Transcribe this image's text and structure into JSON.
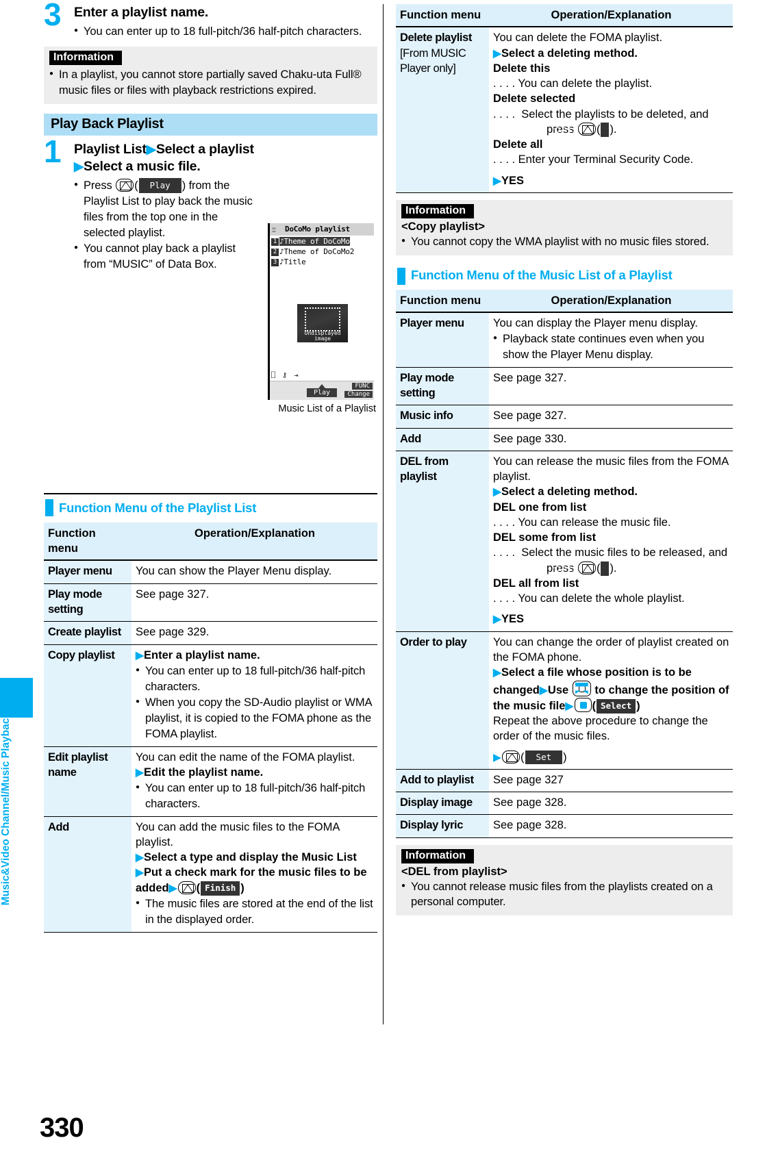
{
  "page": {
    "number": "330",
    "side_tab_label": "Music&Video Channel/Music Playback"
  },
  "left_column": {
    "step3": {
      "number": "3",
      "title": "Enter a playlist name.",
      "bullets": [
        "You can enter up to 18 full-pitch/36 half-pitch characters."
      ]
    },
    "info_top": {
      "tag": "Information",
      "bullets": [
        "In a playlist, you cannot store partially saved Chaku-uta Full® music files or files with playback restrictions expired."
      ]
    },
    "section_bar": "Play Back Playlist",
    "step1": {
      "number": "1",
      "title_line1_a": "Playlist List",
      "title_line1_b": "Select a playlist",
      "title_line2": "Select a music file.",
      "bullets": [
        "Press  (  ) from the Playlist List to play back the music files from the top one in the selected playlist.",
        "You cannot play back a playlist from “MUSIC” of Data Box."
      ],
      "press_key": "mail-key",
      "press_softkey": "Play"
    },
    "screenshot": {
      "caption": "Music List of a Playlist",
      "title": "DoCoMo playlist",
      "rows": [
        {
          "num": "1",
          "text": "Theme of DoCoMo",
          "selected": true
        },
        {
          "num": "2",
          "text": "Theme of DoCoMo2",
          "selected": false
        },
        {
          "num": "3",
          "text": "Title",
          "selected": false
        }
      ],
      "art_caption_line1": "Undisplayed",
      "art_caption_line2": "image",
      "softkey_center": "Play",
      "softkey_right_top": "FUNC",
      "softkey_right_bottom": "Change"
    },
    "sub_head": "Function Menu of the Playlist List",
    "table": {
      "headers": [
        "Function menu",
        "Operation/Explanation"
      ],
      "rows": [
        {
          "name": "Player menu",
          "lines": [
            {
              "text": "You can show the Player Menu display.",
              "style": "plain"
            }
          ]
        },
        {
          "name": "Play mode setting",
          "lines": [
            {
              "text": "See page 327.",
              "style": "plain"
            }
          ]
        },
        {
          "name": "Create playlist",
          "lines": [
            {
              "text": "See page 329.",
              "style": "plain"
            }
          ]
        },
        {
          "name": "Copy playlist",
          "lines": [
            {
              "text": "Enter a playlist name.",
              "style": "tri-bold"
            },
            {
              "text": "You can enter up to 18 full-pitch/36 half-pitch characters.",
              "style": "bullet"
            },
            {
              "text": "When you copy the SD-Audio playlist or WMA playlist, it is copied to the FOMA phone as the FOMA playlist.",
              "style": "bullet"
            }
          ]
        },
        {
          "name": "Edit playlist name",
          "lines": [
            {
              "text": "You can edit the name of the FOMA playlist.",
              "style": "plain"
            },
            {
              "text": "Edit the playlist name.",
              "style": "tri-bold"
            },
            {
              "text": "You can enter up to 18 full-pitch/36 half-pitch characters.",
              "style": "bullet"
            }
          ]
        },
        {
          "name": "Add",
          "lines": [
            {
              "text": "You can add the music files to the FOMA playlist.",
              "style": "plain"
            },
            {
              "text": "Select a type and display the Music List",
              "style": "tri-bold"
            },
            {
              "text": "Put a check mark for the music files to be added",
              "style": "tri-bold-key",
              "key": "mail-key",
              "softkey": "Finish"
            },
            {
              "text": "The music files are stored at the end of the list in the displayed order.",
              "style": "bullet"
            }
          ]
        }
      ]
    }
  },
  "right_column": {
    "table_top": {
      "headers": [
        "Function menu",
        "Operation/Explanation"
      ],
      "rows": [
        {
          "name": "Delete playlist [From MUSIC Player only]",
          "name_line1": "Delete playlist",
          "name_line2": "[From MUSIC",
          "name_line3": "Player only]",
          "lines": [
            {
              "text": "You can delete the FOMA playlist.",
              "style": "plain"
            },
            {
              "text": "Select a deleting method.",
              "style": "tri-bold"
            },
            {
              "text": "Delete this",
              "style": "bold"
            },
            {
              "text": ". . . .  You can delete the playlist.",
              "style": "dots"
            },
            {
              "text": "Delete selected",
              "style": "bold"
            },
            {
              "text": ". . . .  Select the playlists to be deleted, and press",
              "style": "dots-key",
              "key": "mail-key",
              "softkey": "Finish"
            },
            {
              "text": "Delete all",
              "style": "bold"
            },
            {
              "text": ". . . .  Enter your Terminal Security Code.",
              "style": "dots"
            },
            {
              "text": "YES",
              "style": "tri-bold"
            }
          ]
        }
      ]
    },
    "info_copy": {
      "tag": "Information",
      "subtitle": "<Copy playlist>",
      "bullets": [
        "You cannot copy the WMA playlist with no music files stored."
      ]
    },
    "sub_head": "Function Menu of the Music List of a Playlist",
    "table_bottom": {
      "headers": [
        "Function menu",
        "Operation/Explanation"
      ],
      "rows": [
        {
          "name": "Player menu",
          "lines": [
            {
              "text": "You can display the Player menu display.",
              "style": "plain"
            },
            {
              "text": "Playback state continues even when you show the Player Menu display.",
              "style": "bullet"
            }
          ]
        },
        {
          "name": "Play mode setting",
          "lines": [
            {
              "text": "See page 327.",
              "style": "plain"
            }
          ]
        },
        {
          "name": "Music info",
          "lines": [
            {
              "text": "See page 327.",
              "style": "plain"
            }
          ]
        },
        {
          "name": "Add",
          "lines": [
            {
              "text": "See page 330.",
              "style": "plain"
            }
          ]
        },
        {
          "name": "DEL from playlist",
          "lines": [
            {
              "text": "You can release the music files from the FOMA playlist.",
              "style": "plain"
            },
            {
              "text": "Select a deleting method.",
              "style": "tri-bold"
            },
            {
              "text": "DEL one from list",
              "style": "bold"
            },
            {
              "text": ". . . .  You can release the music file.",
              "style": "dots"
            },
            {
              "text": "DEL some from list",
              "style": "bold"
            },
            {
              "text": ". . . .  Select the music files to be released, and press",
              "style": "dots-key",
              "key": "mail-key",
              "softkey": "Finish"
            },
            {
              "text": "DEL all from list",
              "style": "bold"
            },
            {
              "text": ". . . .  You can delete the whole playlist.",
              "style": "dots"
            },
            {
              "text": "YES",
              "style": "tri-bold"
            }
          ]
        },
        {
          "name": "Order to play",
          "lines": [
            {
              "text": "You can change the order of playlist created on the FOMA phone.",
              "style": "plain"
            },
            {
              "text": "Select a file whose position is to be changed",
              "style": "tri-bold"
            },
            {
              "text": "Use",
              "style": "special-order"
            },
            {
              "text": "Repeat the above procedure to change the order of the music files.",
              "style": "plain"
            },
            {
              "text": "",
              "style": "final-set",
              "key": "mail-key",
              "softkey": "Set"
            }
          ],
          "order_parts": {
            "use": "Use",
            "multi_key": "multi-cursor-key",
            "mid": "to change the position of the music file",
            "center_key": "center-key",
            "select_softkey": "Select"
          }
        },
        {
          "name": "Add to playlist",
          "lines": [
            {
              "text": "See page 327",
              "style": "plain"
            }
          ]
        },
        {
          "name": "Display image",
          "lines": [
            {
              "text": "See page 328.",
              "style": "plain"
            }
          ]
        },
        {
          "name": "Display lyric",
          "lines": [
            {
              "text": "See page 328.",
              "style": "plain"
            }
          ]
        }
      ]
    },
    "info_del": {
      "tag": "Information",
      "subtitle": "<DEL from playlist>",
      "bullets": [
        "You cannot release music files from the playlists created on a personal computer."
      ]
    }
  },
  "colors": {
    "accent_cyan": "#00AEEF",
    "section_bar_blue": "#AEDEF5",
    "table_header_blue": "#DCF0FB",
    "table_cell_blue": "#E2F3FC",
    "info_gray": "#EDEDED"
  }
}
